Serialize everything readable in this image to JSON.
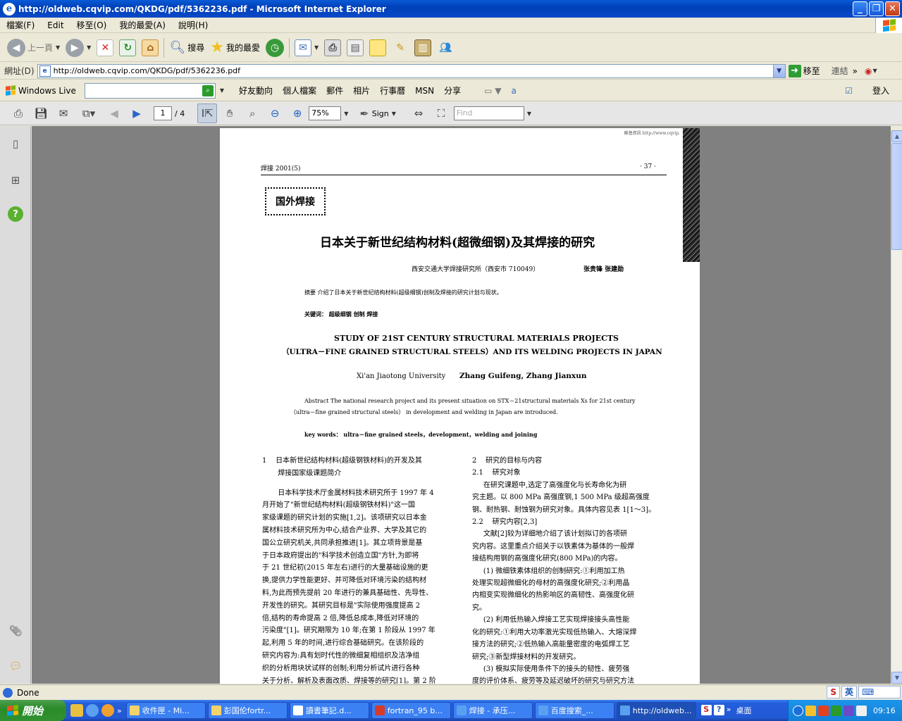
{
  "window": {
    "title": "http://oldweb.cqvip.com/QKDG/pdf/5362236.pdf - Microsoft Internet Explorer",
    "minimize": "_",
    "maximize": "❐",
    "close": "✕"
  },
  "menu": [
    "檔案(F)",
    "Edit",
    "移至(O)",
    "我的最愛(A)",
    "說明(H)"
  ],
  "toolbar": {
    "back": "上一頁",
    "search": "搜尋",
    "favorites": "我的最愛"
  },
  "address": {
    "label": "網址(D)",
    "url": "http://oldweb.cqvip.com/QKDG/pdf/5362236.pdf",
    "go": "移至",
    "links": "連結"
  },
  "live": {
    "title": "Windows Live",
    "items": [
      "好友動向",
      "個人檔案",
      "郵件",
      "相片",
      "行事曆",
      "MSN",
      "分享"
    ],
    "signin": "登入"
  },
  "pdf": {
    "page_current": "1",
    "page_total": "/ 4",
    "zoom": "75%",
    "sign": "Sign",
    "find_placeholder": "Find"
  },
  "doc": {
    "watermark": "維普資訊 http://www.cqvip.",
    "journal": "焊接  2001(5)",
    "page_no": "· 37 ·",
    "stamp": "国外焊接",
    "title_cn": "日本关于新世纪结构材料(超微细钢)及其焊接的研究",
    "affil_cn": "西安交通大学焊接研究所（西安市 710049）",
    "authors_cn": "张贵锋    张建勋",
    "abstract_cn": "摘要   介绍了日本关于新世纪结构材料(超级细钢)创制及焊接的研究计划与现状。",
    "keywords_cn": "关键词：  超级细钢    创制    焊接",
    "title_en_1": "STUDY OF 21ST CENTURY STRUCTURAL MATERIALS PROJECTS",
    "title_en_2": "（ULTRA－FINE GRAINED STRUCTURAL STEELS）AND ITS WELDING PROJECTS IN JAPAN",
    "univ_en": "Xi'an Jiaotong University",
    "authors_en": "Zhang Guifeng, Zhang Jianxun",
    "abstract_en_1": "Abstract   The national research project and its present situation on STX－21structural materials Xs for 21st century",
    "abstract_en_2": "（ultra－fine grained structural steels） in development and welding in Japan are introduced.",
    "keywords_en": "key words：  ultra－fine grained steels，development，welding and joining",
    "left_col": [
      "1    日本新世纪结构材料(超级钢铁材料)的开发及其",
      "       焊接国家级课题简介",
      "",
      "       日本科学技术厅金属材料技术研究所于 1997 年 4",
      "月开始了\"新世纪结构材料(超级钢铁材料)\"这一国",
      "家级课题的研究计划的实施[1,2]。该项研究以日本金",
      "属材料技术研究所为中心,结合产业界、大学及其它的",
      "国公立研究机关,共同承担推进[1]。其立项背景是基",
      "于日本政府提出的\"科学技术创造立国\"方针,为即将",
      "于 21 世纪初(2015 年左右)进行的大量基础设施的更",
      "换,提供力学性能更好、并可降低对环境污染的结构材",
      "料,为此而预先提前 20 年进行的兼具基础性、先导性、",
      "开发性的研究。其研究目标是\"实际使用强度提高 2",
      "倍,结构的寿命提高 2 倍,降低总成本,降低对环境的",
      "污染度\"[1]。研究期限为 10 年;在第 1 阶段从 1997 年",
      "起,利用 5 年的时间,进行综合基础研究。在该阶段的",
      "研究内容为:具有划时代性的微细复相组织及洁净组",
      "织的分析用块状试样的创制;利用分析试片进行各种",
      "关于分析、解析及表面改质、焊接等的研究[1]。第 2 阶"
    ],
    "right_col": [
      "2    研究的目标与内容",
      "2.1    研究对象",
      "     在研究课题中,选定了高强度化与长寿命化为研",
      "究主题。以 800 MPa 高强度钢,1 500 MPa 级超高强度",
      "钢、耐热钢、耐蚀钢为研究对象。具体内容见表 1[1～3]。",
      "2.2    研究内容[2,3]",
      "     文献[2]较为详细地介绍了该计划拟订的各项研",
      "究内容。这里重点介绍关于以铁素体为基体的一般焊",
      "接结构用钢的高强度化研究(800 MPa)的内容。",
      "     (1) 微细铁素体组织的创制研究:①利用加工热",
      "处理实现超微细化的母材的高强度化研究;②利用晶",
      "内相变实现微细化的热影响区的高韧性、高强度化研",
      "究。",
      "     (2) 利用低热输入焊接工艺实现焊接接头高性能",
      "化的研究:①利用大功率激光实现低热输入、大熔深焊",
      "接方法的研究;②低热输入高能量密度的电弧焊工艺",
      "研究;③新型焊接材料的开发研究。",
      "     (3) 模拟实际使用条件下的接头的韧性、疲劳强",
      "度的评价体系、疲劳等及延迟破坏的研究与研究方法"
    ]
  },
  "status": {
    "text": "Done",
    "ime_label": "英"
  },
  "taskbar": {
    "start": "開始",
    "tasks": [
      "收件匣 - Mi...",
      "彭国伦fortr...",
      "讀書筆記.d...",
      "fortran_95 b...",
      "焊接 - 承压...",
      "百度搜索_...",
      "http://oldweb..."
    ],
    "desktop": "桌面",
    "clock": "09:16"
  }
}
